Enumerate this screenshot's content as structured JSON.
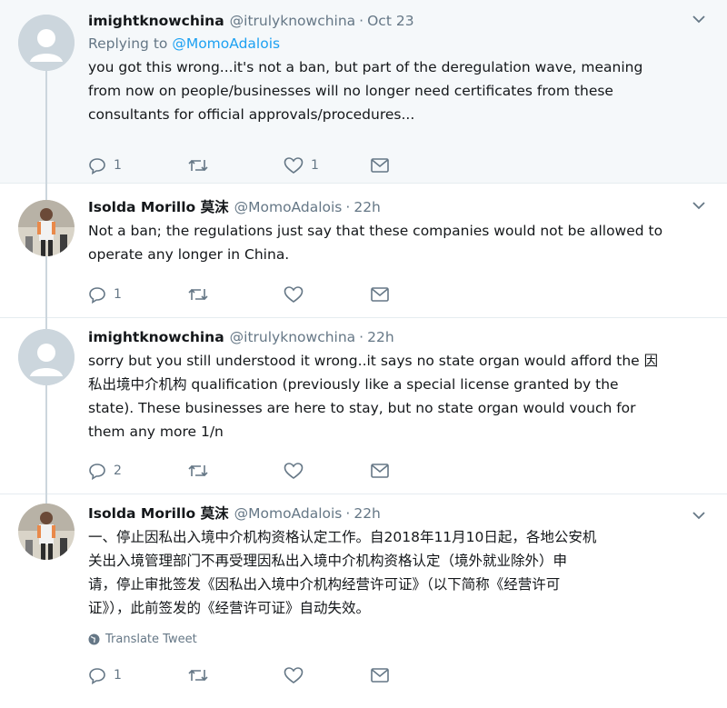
{
  "tweets": [
    {
      "name": "imightknowchina",
      "handle": "@itrulyknowchina",
      "sep": "·",
      "time": "Oct 23",
      "replying_label": "Replying to",
      "replying_to": "@MomoAdalois",
      "text": "you got this wrong...it's not a ban, but part of the deregulation wave, meaning\nfrom now on people/businesses will no longer need certificates from these\nconsultants for official approvals/procedures...",
      "replies": "1",
      "retweets": "",
      "likes": "1",
      "avatar": "default-avatar"
    },
    {
      "name": "Isolda Morillo 莫沫",
      "handle": "@MomoAdalois",
      "sep": "·",
      "time": "22h",
      "text": "Not a ban; the regulations just say that these companies would not be allowed to\noperate any longer in China.",
      "replies": "1",
      "retweets": "",
      "likes": "",
      "avatar": "photo-avatar"
    },
    {
      "name": "imightknowchina",
      "handle": "@itrulyknowchina",
      "sep": "·",
      "time": "22h",
      "text": "sorry but you still understood it wrong..it says no state organ would afford the 因\n私出境中介机构 qualification (previously like a special license granted by the\nstate). These businesses are here to stay, but no state organ would vouch for\nthem any more 1/n",
      "replies": "2",
      "retweets": "",
      "likes": "",
      "avatar": "default-avatar"
    },
    {
      "name": "Isolda Morillo 莫沫",
      "handle": "@MomoAdalois",
      "sep": "·",
      "time": "22h",
      "text": "一、停止因私出入境中介机构资格认定工作。自2018年11月10日起，各地公安机\n关出入境管理部门不再受理因私出入境中介机构资格认定（境外就业除外）申\n请，停止审批签发《因私出入境中介机构经营许可证》（以下简称《经营许可\n证》），此前签发的《经营许可证》自动失效。",
      "translate": "Translate Tweet",
      "replies": "1",
      "retweets": "",
      "likes": "",
      "avatar": "photo-avatar"
    }
  ],
  "icons": {
    "reply": "reply-icon",
    "retweet": "retweet-icon",
    "like": "heart-icon",
    "dm": "envelope-icon",
    "more": "chevron-down-icon",
    "translate": "globe-icon"
  },
  "colors": {
    "highlight_bg": "#f5f8fa",
    "link": "#1da1f2",
    "muted": "#657786",
    "text": "#14171a",
    "border": "#e6ecf0"
  }
}
